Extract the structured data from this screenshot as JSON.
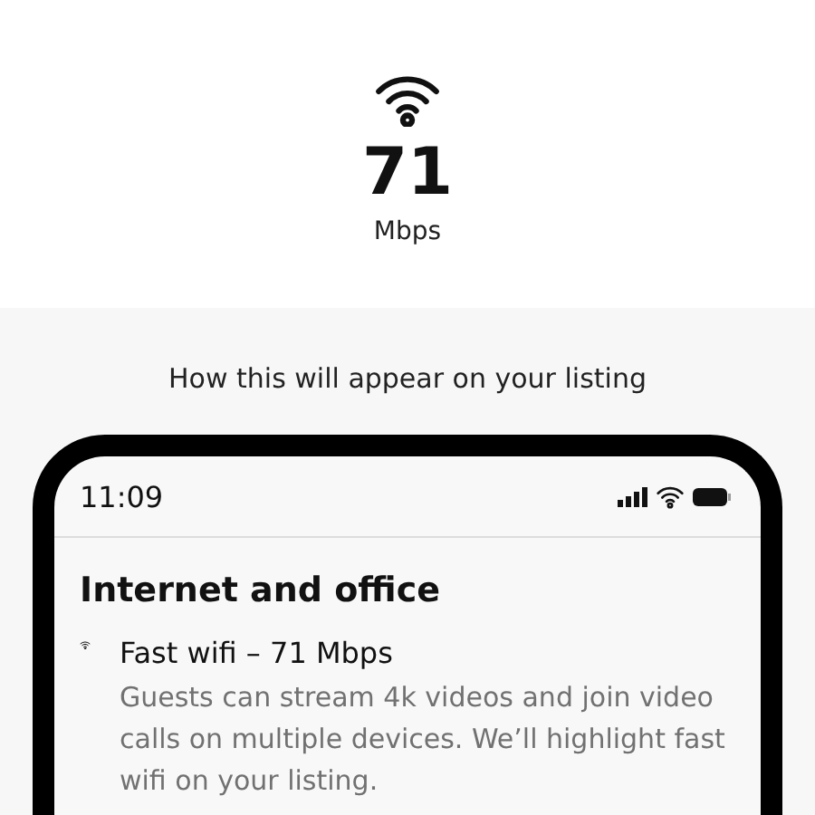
{
  "speed": {
    "value": "71",
    "unit": "Mbps"
  },
  "preview": {
    "caption": "How this will appear on your listing",
    "phone": {
      "time": "11:09",
      "section_title": "Internet and office",
      "amenity": {
        "title": "Fast wifi – 71 Mbps",
        "description": "Guests can stream 4k videos and join video calls on multiple devices. We’ll highlight fast wifi on your listing."
      }
    }
  }
}
